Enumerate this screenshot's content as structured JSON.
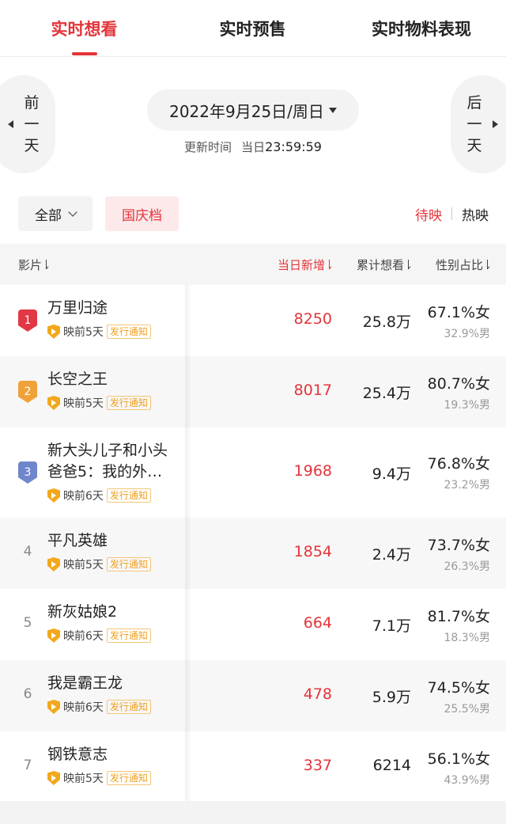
{
  "tabs": [
    {
      "label": "实时想看",
      "active": true
    },
    {
      "label": "实时预售",
      "active": false
    },
    {
      "label": "实时物料表现",
      "active": false
    }
  ],
  "date_nav": {
    "prev_label": "前一天",
    "next_label": "后一天",
    "date": "2022年9月25日/周日",
    "update_label": "更新时间",
    "update_day": "当日",
    "update_time": "23:59:59"
  },
  "filters": {
    "all_label": "全部",
    "holiday_label": "国庆档",
    "status_active": "待映",
    "status_inactive": "热映"
  },
  "table": {
    "headers": {
      "film": "影片",
      "today": "当日新增",
      "total": "累计想看",
      "gender": "性别占比"
    },
    "notice_label": "发行通知",
    "rows": [
      {
        "rank": "1",
        "title": "万里归途",
        "days": "映前5天",
        "today": "8250",
        "total": "25.8万",
        "female": "67.1%女",
        "male": "32.9%男"
      },
      {
        "rank": "2",
        "title": "长空之王",
        "days": "映前5天",
        "today": "8017",
        "total": "25.4万",
        "female": "80.7%女",
        "male": "19.3%男"
      },
      {
        "rank": "3",
        "title": "新大头儿子和小头爸爸5：我的外…",
        "days": "映前6天",
        "today": "1968",
        "total": "9.4万",
        "female": "76.8%女",
        "male": "23.2%男"
      },
      {
        "rank": "4",
        "title": "平凡英雄",
        "days": "映前5天",
        "today": "1854",
        "total": "2.4万",
        "female": "73.7%女",
        "male": "26.3%男"
      },
      {
        "rank": "5",
        "title": "新灰姑娘2",
        "days": "映前6天",
        "today": "664",
        "total": "7.1万",
        "female": "81.7%女",
        "male": "18.3%男"
      },
      {
        "rank": "6",
        "title": "我是霸王龙",
        "days": "映前6天",
        "today": "478",
        "total": "5.9万",
        "female": "74.5%女",
        "male": "25.5%男"
      },
      {
        "rank": "7",
        "title": "钢铁意志",
        "days": "映前5天",
        "today": "337",
        "total": "6214",
        "female": "56.1%女",
        "male": "43.9%男"
      }
    ]
  },
  "colors": {
    "accent": "#e3343a",
    "rank1": "#e23744",
    "rank2": "#f0a23a",
    "rank3": "#6f86cc",
    "shield": "#f2a81c"
  }
}
